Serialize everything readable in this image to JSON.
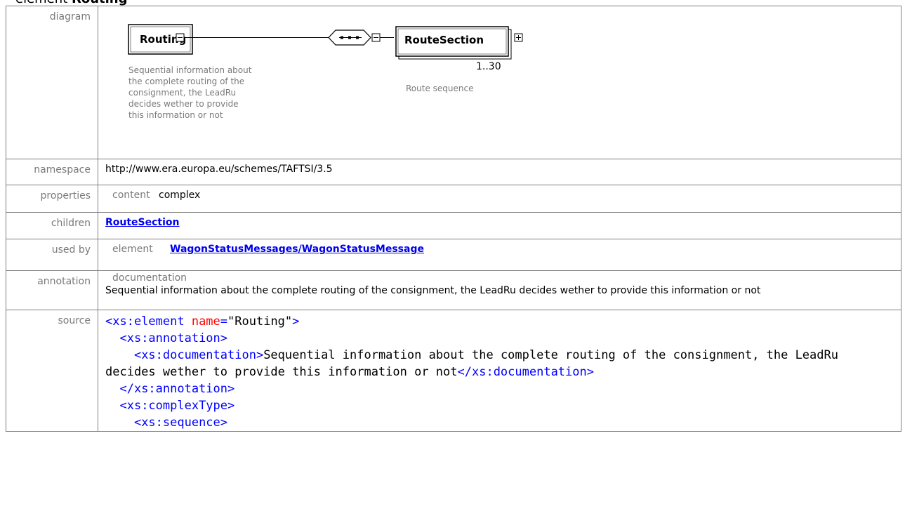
{
  "page": {
    "heading_prefix": "element",
    "heading_name": "Routing"
  },
  "rows": {
    "diagram_label": "diagram",
    "namespace_label": "namespace",
    "properties_label": "properties",
    "children_label": "children",
    "used_by_label": "used by",
    "annotation_label": "annotation",
    "source_label": "source"
  },
  "diagram": {
    "element_name": "Routing",
    "element_doc": [
      "Sequential information about",
      "the complete routing of the",
      "consignment, the LeadRu",
      "decides wether to provide",
      "this information or not"
    ],
    "child_name": "RouteSection",
    "child_cardinality": "1..30",
    "child_doc": "Route sequence",
    "icons": {
      "collapse": "minus-box-icon",
      "expand": "plus-box-icon",
      "sequence": "sequence-compositor-icon"
    }
  },
  "namespace": {
    "value": "http://www.era.europa.eu/schemes/TAFTSI/3.5"
  },
  "properties": {
    "key": "content",
    "value": "complex"
  },
  "children": {
    "link": "RouteSection"
  },
  "used_by": {
    "kind": "element",
    "link": "WagonStatusMessages/WagonStatusMessage"
  },
  "annotation": {
    "kind": "documentation",
    "text": "Sequential information about the complete routing of the consignment, the LeadRu  decides wether to provide this information or not"
  },
  "source": {
    "l1_open": "<xs:element ",
    "l1_attr": "name",
    "l1_eq": "=",
    "l1_val": "\"Routing\"",
    "l1_close": ">",
    "l2": "<xs:annotation>",
    "l3_open": "<xs:documentation>",
    "l3_text": "Sequential information about the complete routing of the consignment, the LeadRu  decides wether to provide this information or not",
    "l3_close": "</xs:documentation>",
    "l4": "</xs:annotation>",
    "l5": "<xs:complexType>",
    "l6": "<xs:sequence>"
  },
  "colors": {
    "link": "#0000ee",
    "label_grey": "#7a7a7a",
    "border": "#7f7f7f",
    "xml_tag": "#0000ff",
    "xml_attr": "#ff0000"
  }
}
